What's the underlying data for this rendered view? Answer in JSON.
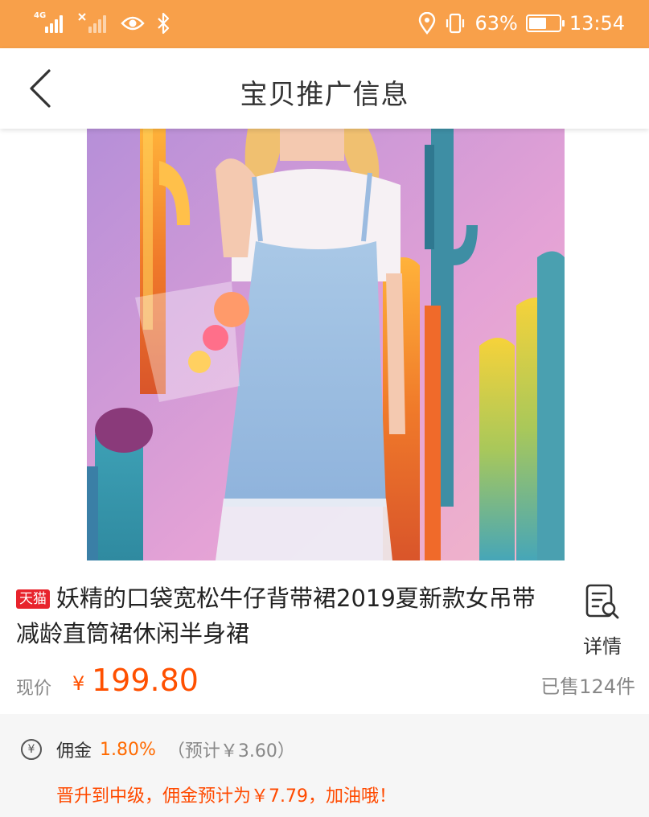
{
  "status_bar": {
    "signal1_tag": "4G",
    "battery": "63%",
    "battery_level": 0.63,
    "time": "13:54",
    "icons": [
      "signal-4g-icon",
      "signal-no-sim-icon",
      "eye-comfort-icon",
      "bluetooth-icon",
      "location-icon",
      "vibrate-icon",
      "battery-icon"
    ],
    "bg_color": "#f8a04a"
  },
  "nav": {
    "title": "宝贝推广信息",
    "back_icon": "chevron-left-icon"
  },
  "product": {
    "badge": "天猫",
    "title": "妖精的口袋宽松牛仔背带裙2019夏新款女吊带减龄直筒裙休闲半身裙",
    "detail_label": "详情",
    "detail_icon": "document-search-icon",
    "price_label": "现价",
    "currency": "¥",
    "price": "199.80",
    "sold": "已售124件",
    "accent_color": "#ff5000"
  },
  "commission": {
    "icon_glyph": "¥",
    "label": "佣金",
    "rate": "1.80%",
    "estimate": "（预计￥3.60）",
    "promo": "晋升到中级，佣金预计为￥7.79，加油哦！"
  }
}
